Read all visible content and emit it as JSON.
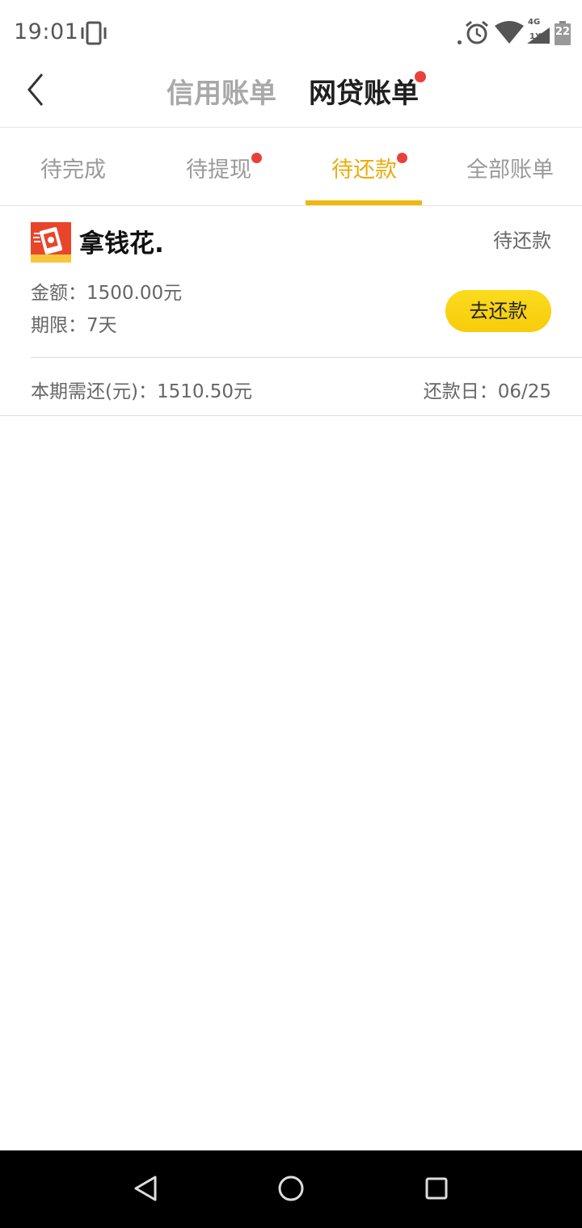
{
  "status_bar": {
    "time": "19:01",
    "network_top": "4G",
    "network_bottom": "1X",
    "battery": "22",
    "icons": [
      "vibrate-icon",
      "alarm-icon",
      "wifi-icon",
      "signal-icon",
      "battery-icon"
    ]
  },
  "header": {
    "back_icon": "chevron-left-icon",
    "tabs": [
      {
        "label": "信用账单",
        "active": false,
        "dot": false
      },
      {
        "label": "网贷账单",
        "active": true,
        "dot": true
      }
    ]
  },
  "sub_tabs": [
    {
      "label": "待完成",
      "active": false,
      "dot": false
    },
    {
      "label": "待提现",
      "active": false,
      "dot": true
    },
    {
      "label": "待还款",
      "active": true,
      "dot": true
    },
    {
      "label": "全部账单",
      "active": false,
      "dot": false
    }
  ],
  "loan_card": {
    "name": "拿钱花.",
    "status": "待还款",
    "amount": "金额：1500.00元",
    "term": "期限：7天",
    "button_label": "去还款",
    "due_amount": "本期需还(元)：1510.50元",
    "due_date": "还款日：06/25"
  },
  "colors": {
    "accent": "#f2b70e",
    "active_tab_text": "#e9ad0c",
    "badge": "#e8413c",
    "button": "#f9d416"
  },
  "nav_bar": {
    "icons": [
      "nav-back-icon",
      "nav-home-icon",
      "nav-recent-icon"
    ]
  }
}
